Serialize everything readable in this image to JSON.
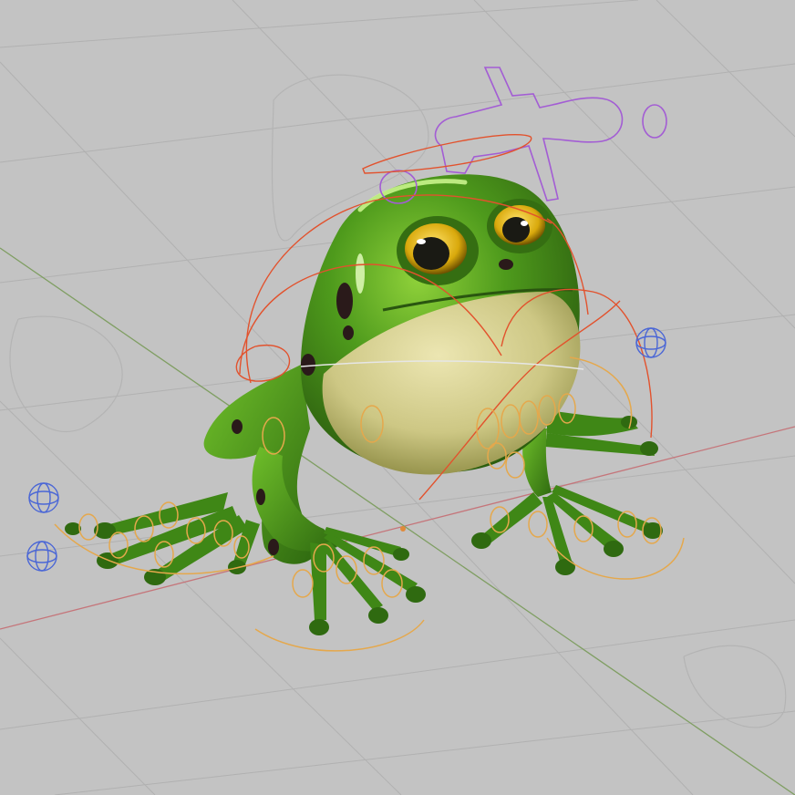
{
  "viewport": {
    "mode": "3d-viewport",
    "background": "#c3c3c3",
    "grid_color": "#b0b0b0",
    "axis_x_color": "#c0666b",
    "axis_y_color": "#7a9a5a"
  },
  "model": {
    "name": "frog",
    "body_color": "#4f9a1a",
    "belly_color": "#d7d08c",
    "eye_color": "#e2b80e"
  },
  "rig": {
    "ik_controls_color": "#e3a64a",
    "fk_controls_color": "#e04a2a",
    "root_control_color": "#9a5ad0",
    "pole_targets_color": "#4b67d6",
    "pole_targets": [
      "pole-target-front-left",
      "pole-target-back-left",
      "pole-target-back-right"
    ]
  }
}
